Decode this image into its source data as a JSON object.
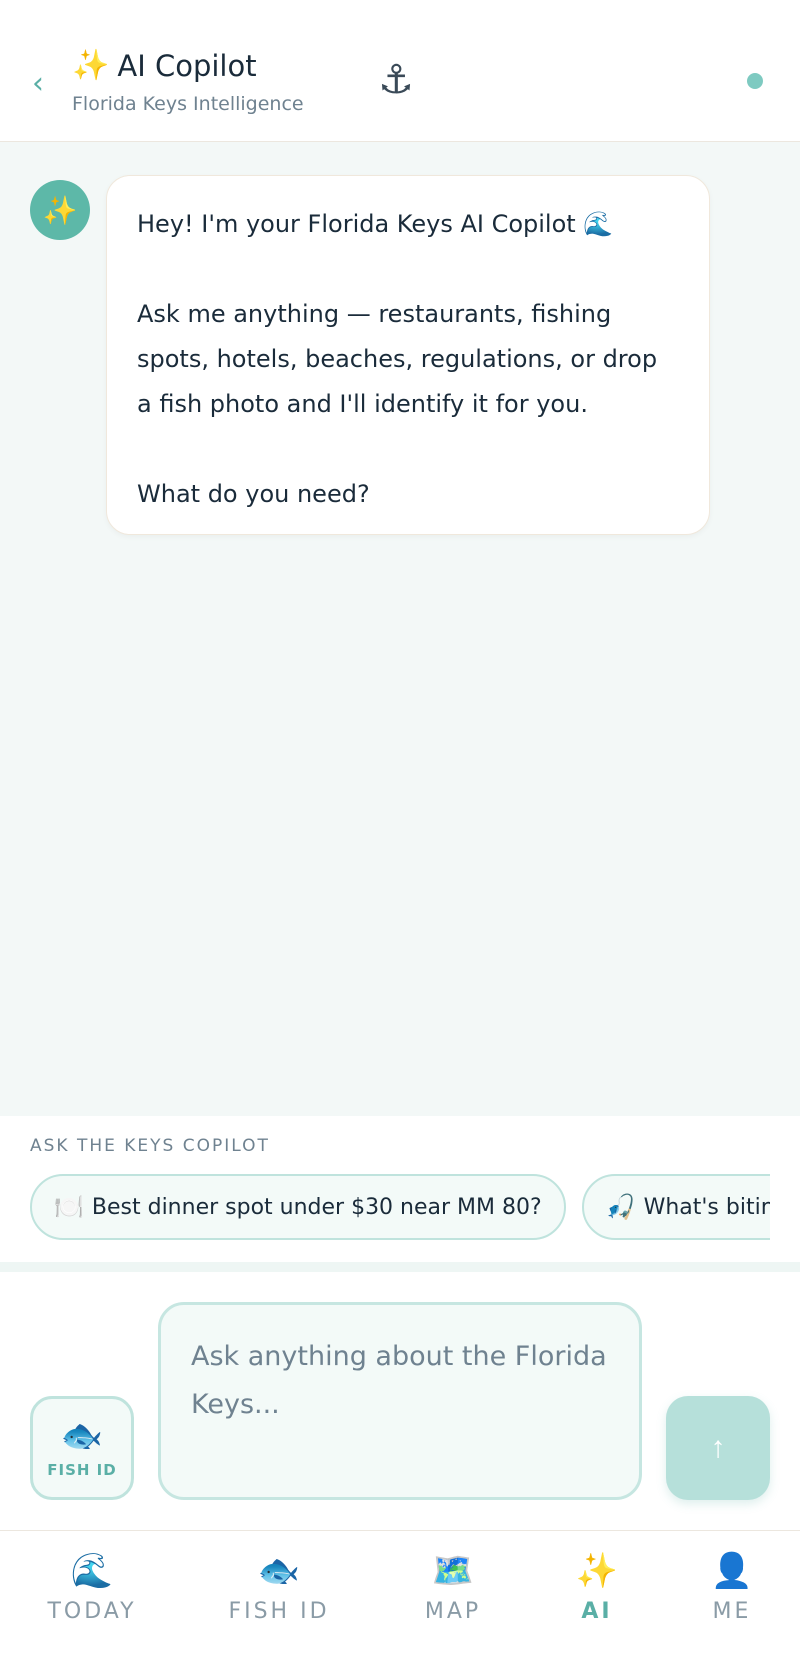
{
  "header": {
    "back_icon": "chevron-left-icon",
    "back_glyph": "‹",
    "title_icon": "✨",
    "title": "AI Copilot",
    "subtitle": "Florida Keys Intelligence",
    "logo_glyph": "⚓",
    "status_color": "#7ecac1"
  },
  "chat": {
    "avatar_glyph": "✨",
    "messages": [
      {
        "role": "assistant",
        "lines": [
          "Hey! I'm your Florida Keys AI Copilot 🌊",
          "Ask me anything — restaurants, fishing spots, hotels, beaches, regulations, or drop a fish photo and I'll identify it for you.",
          "What do you need?"
        ]
      }
    ]
  },
  "suggestions": {
    "label": "ASK THE KEYS COPILOT",
    "chips": [
      {
        "icon": "🍽️",
        "text": "Best dinner spot under $30 near MM 80?"
      },
      {
        "icon": "🎣",
        "text": "What's biting near Islamorada?"
      }
    ]
  },
  "composer": {
    "fish_button": {
      "icon": "🐟",
      "label": "FISH ID"
    },
    "input_value": "",
    "input_placeholder": "Ask anything about the Florida Keys...",
    "send_glyph": "↑"
  },
  "tabs": [
    {
      "icon": "🌊",
      "label": "TODAY",
      "active": false
    },
    {
      "icon": "🐟",
      "label": "FISH ID",
      "active": false
    },
    {
      "icon": "🗺️",
      "label": "MAP",
      "active": false
    },
    {
      "icon": "✨",
      "label": "AI",
      "active": true
    },
    {
      "icon": "👤",
      "label": "ME",
      "active": false
    }
  ],
  "colors": {
    "accent": "#5aafa6",
    "background": "#f3f8f7",
    "text": "#1a2b3a",
    "muted": "#6f8290"
  }
}
